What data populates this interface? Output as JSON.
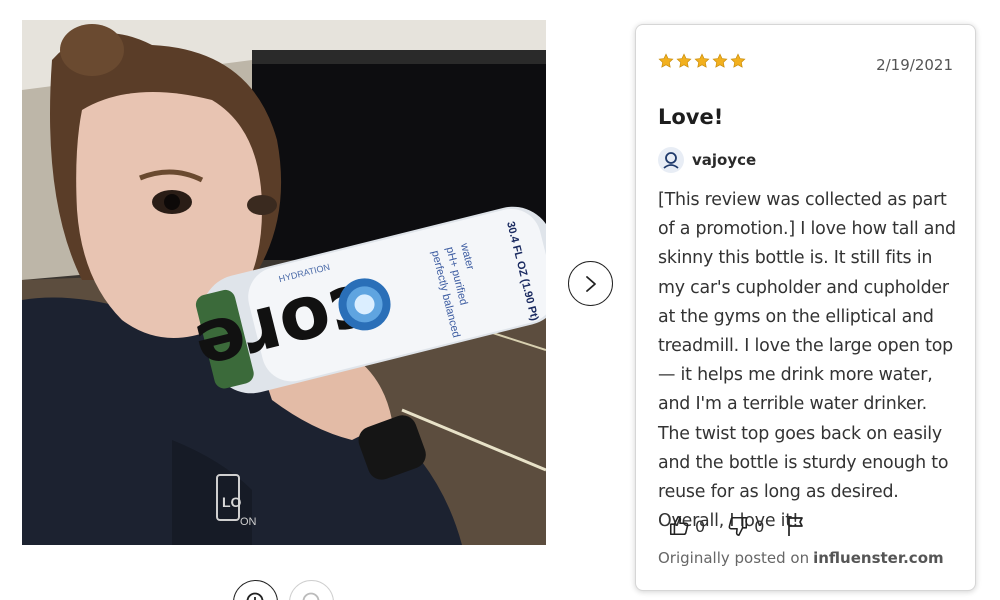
{
  "photo": {
    "bottle_brand": "core",
    "bottle_label_lines": [
      "perfectly balanced",
      "pH+ purified",
      "water"
    ],
    "bottle_volume": "30.4 FL OZ (1.90 Pt)",
    "bottle_hydration": "HYDRATION",
    "hoodie_text": "LO",
    "hoodie_text2": "ON"
  },
  "navigation": {
    "next_icon": "chevron-right-icon",
    "zoom_icon": "zoom-in-icon"
  },
  "review": {
    "rating": 5,
    "rating_max": 5,
    "star_color": "#f2b01e",
    "date": "2/19/2021",
    "title": "Love!",
    "author": "vajoyce",
    "body": "[This review was collected as part of a promotion.] I love how tall and skinny this bottle is. It still fits in my car's cupholder and cupholder at the gyms on the elliptical and treadmill. I love the large open top — it helps me drink more water, and I'm a terrible water drinker. The twist top goes back on easily and the bottle is sturdy enough to reuse for as long as desired. Overall, I love it!",
    "helpful_count": "0",
    "unhelpful_count": "0",
    "source_prefix": "Originally posted on",
    "source_site": "influenster.com"
  }
}
